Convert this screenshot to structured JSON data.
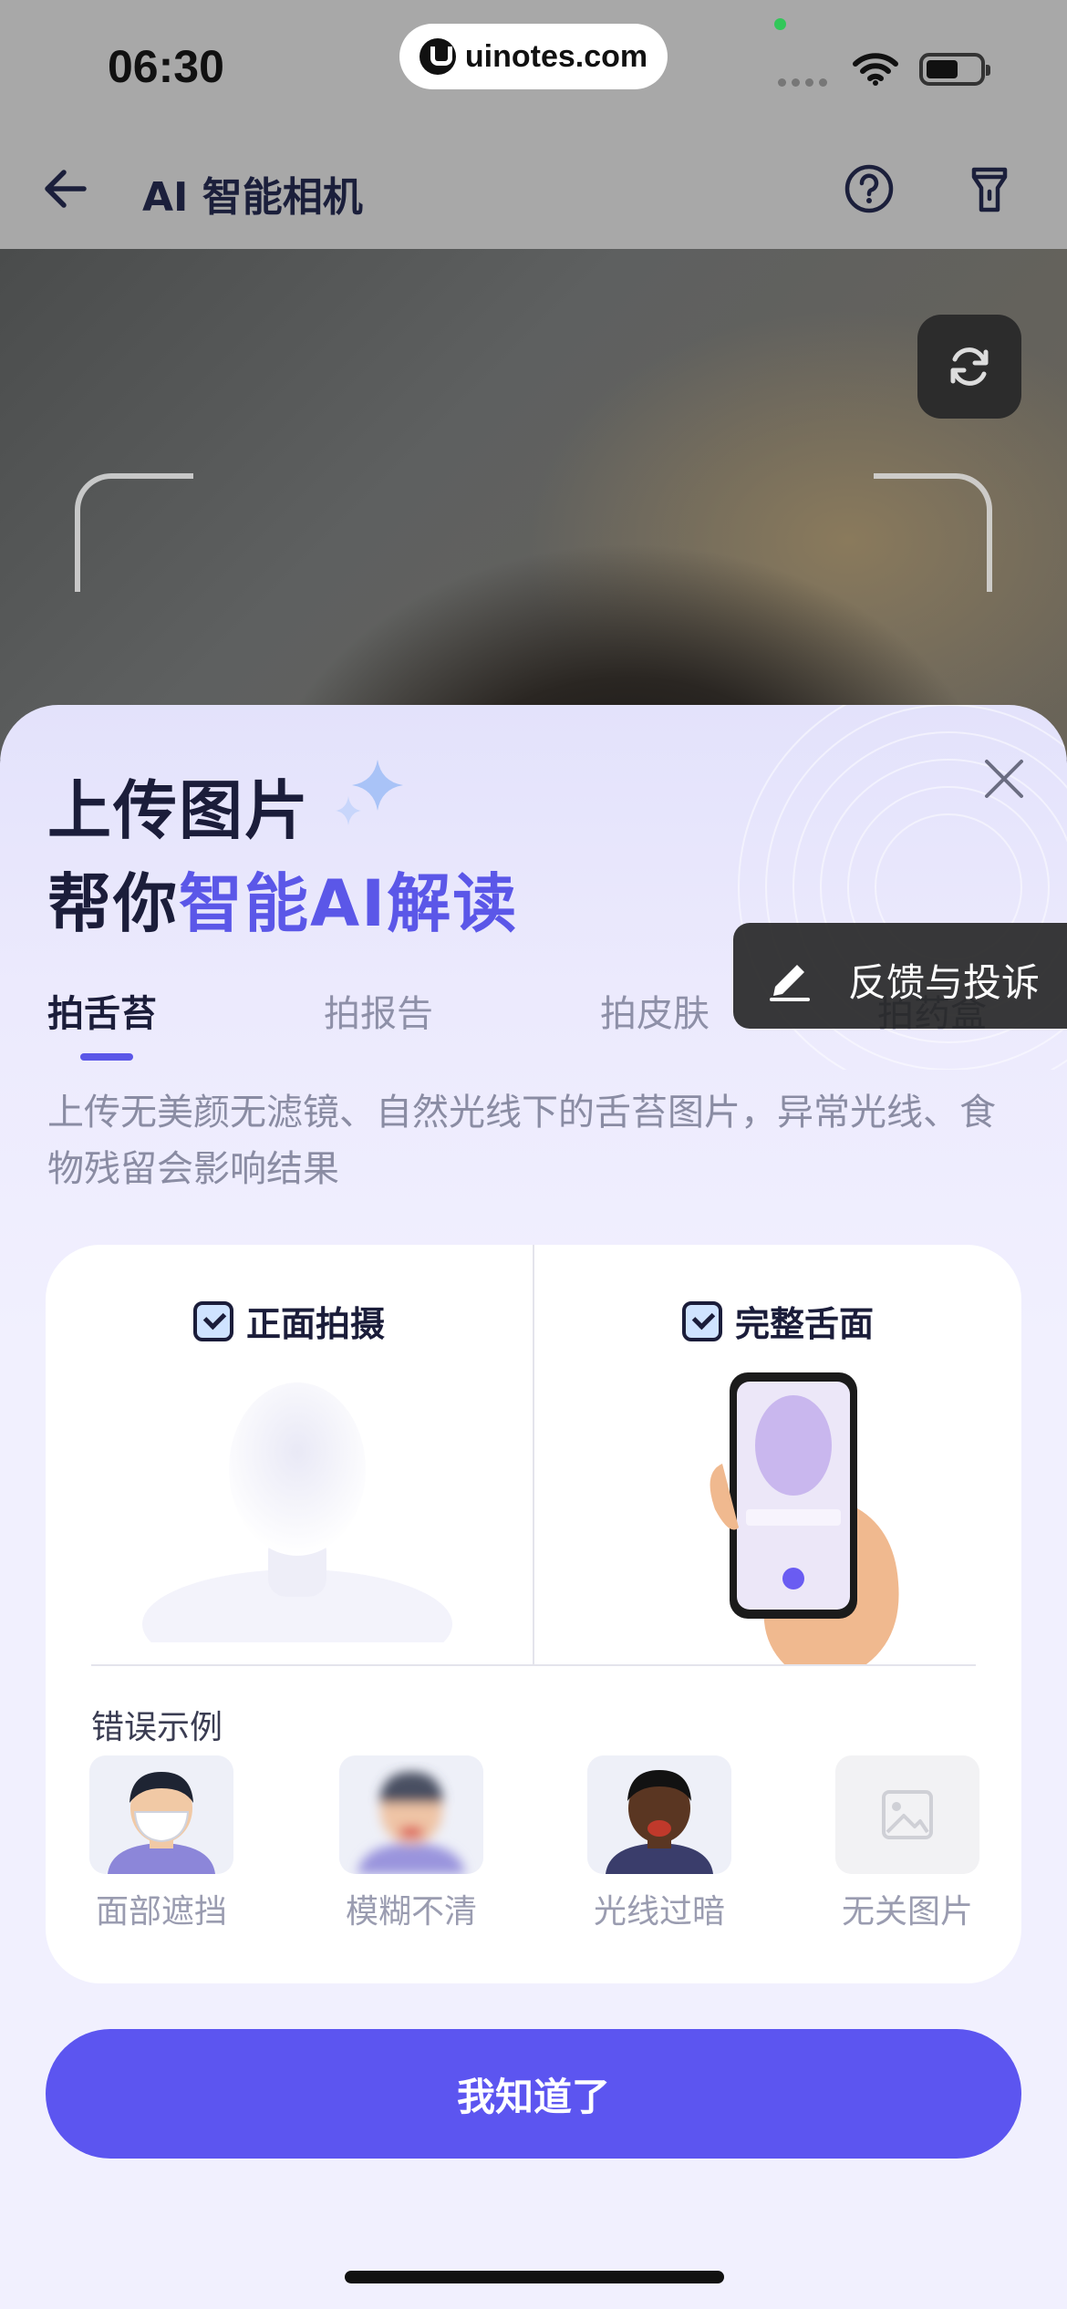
{
  "status_bar": {
    "time": "06:30",
    "url": "uinotes.com"
  },
  "header": {
    "title": "AI 智能相机"
  },
  "sheet": {
    "title_line1": "上传图片",
    "title_line2_prefix": "帮你",
    "title_line2_accent": "智能AI解读",
    "tabs": [
      {
        "label": "拍舌苔",
        "active": true
      },
      {
        "label": "拍报告",
        "active": false
      },
      {
        "label": "拍皮肤",
        "active": false
      },
      {
        "label": "拍药盒",
        "active": false
      }
    ],
    "description": "上传无美颜无滤镜、自然光线下的舌苔图片，异常光线、食物残留会影响结果",
    "card": {
      "good_examples": [
        {
          "label": "正面拍摄"
        },
        {
          "label": "完整舌面"
        }
      ],
      "wrong_title": "错误示例",
      "wrong_examples": [
        {
          "label": "面部遮挡"
        },
        {
          "label": "模糊不清"
        },
        {
          "label": "光线过暗"
        },
        {
          "label": "无关图片"
        }
      ]
    },
    "confirm_button": "我知道了"
  },
  "feedback": {
    "label": "反馈与投诉"
  },
  "colors": {
    "accent": "#5b57e8",
    "button": "#5c55f0",
    "sheet_bg": "#f1f0fe"
  }
}
